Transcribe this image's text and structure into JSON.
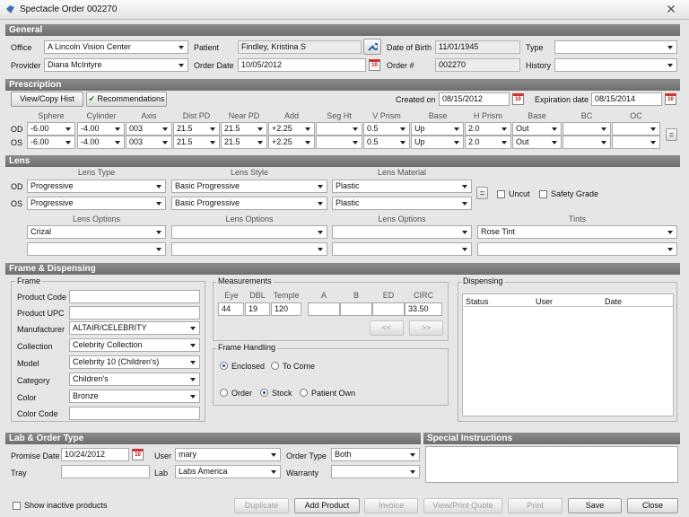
{
  "window": {
    "title": "Spectacle Order 002270"
  },
  "general": {
    "header": "General",
    "office_label": "Office",
    "office_value": "A Lincoln Vision Center",
    "patient_label": "Patient",
    "patient_value": "Findley, Kristina S",
    "dob_label": "Date of Birth",
    "dob_value": "11/01/1945",
    "type_label": "Type",
    "type_value": "",
    "provider_label": "Provider",
    "provider_value": "Diana McIntyre",
    "order_date_label": "Order Date",
    "order_date_value": "10/05/2012",
    "order_num_label": "Order #",
    "order_num_value": "002270",
    "history_label": "History",
    "history_value": ""
  },
  "prescription": {
    "header": "Prescription",
    "view_copy_button": "View/Copy Hist",
    "recommendations_button": "Recommendations",
    "created_label": "Created on",
    "created_value": "08/15/2012",
    "expiration_label": "Expiration date",
    "expiration_value": "08/15/2014",
    "columns": [
      "Sphere",
      "Cylinder",
      "Axis",
      "Dist PD",
      "Near PD",
      "Add",
      "Seg Ht",
      "V Prism",
      "Base",
      "H Prism",
      "Base",
      "BC",
      "OC"
    ],
    "rows": [
      {
        "eye": "OD",
        "values": [
          "-6.00",
          "-4.00",
          "003",
          "21.5",
          "21.5",
          "+2.25",
          "",
          "0.5",
          "Up",
          "2.0",
          "Out",
          "",
          ""
        ]
      },
      {
        "eye": "OS",
        "values": [
          "-6.00",
          "-4.00",
          "003",
          "21.5",
          "21.5",
          "+2.25",
          "",
          "0.5",
          "Up",
          "2.0",
          "Out",
          "",
          ""
        ]
      }
    ],
    "equals_button": "="
  },
  "lens": {
    "header": "Lens",
    "type_header": "Lens Type",
    "style_header": "Lens Style",
    "material_header": "Lens Material",
    "od_label": "OD",
    "os_label": "OS",
    "od": {
      "type": "Progressive",
      "style": "Basic Progressive",
      "material": "Plastic"
    },
    "os": {
      "type": "Progressive",
      "style": "Basic Progressive",
      "material": "Plastic"
    },
    "equals_button": "=",
    "uncut_label": "Uncut",
    "safety_label": "Safety Grade",
    "options_header": "Lens Options",
    "tints_header": "Tints",
    "options_row1": [
      "Crizal",
      "",
      "",
      "Rose Tint"
    ],
    "options_row2": [
      "",
      "",
      "",
      ""
    ]
  },
  "frame_dispensing": {
    "header": "Frame & Dispensing",
    "frame_group": "Frame",
    "fields": [
      {
        "label": "Product Code",
        "value": ""
      },
      {
        "label": "Product UPC",
        "value": ""
      },
      {
        "label": "Manufacturer",
        "value": "ALTAIR/CELEBRITY"
      },
      {
        "label": "Collection",
        "value": "Celebrity Collection"
      },
      {
        "label": "Model",
        "value": "Celebrity 10 (Children's)"
      },
      {
        "label": "Category",
        "value": "Children's"
      },
      {
        "label": "Color",
        "value": "Bronze"
      },
      {
        "label": "Color Code",
        "value": ""
      }
    ],
    "measurements_group": "Measurements",
    "meas_headers": [
      "Eye",
      "DBL",
      "Temple",
      "A",
      "B",
      "ED",
      "CIRC"
    ],
    "meas_values": [
      "44",
      "19",
      "120",
      "",
      "",
      "",
      "33.50"
    ],
    "prev_button": "<<",
    "next_button": ">>",
    "handling_group": "Frame Handling",
    "enclosed_label": "Enclosed",
    "to_come_label": "To Come",
    "order_label": "Order",
    "stock_label": "Stock",
    "patient_own_label": "Patient Own",
    "dispensing_group": "Dispensing",
    "disp_headers": [
      "Status",
      "User",
      "Date"
    ]
  },
  "lab_order": {
    "header": "Lab & Order Type",
    "promise_label": "Promise Date",
    "promise_value": "10/24/2012",
    "user_label": "User",
    "user_value": "mary",
    "order_type_label": "Order Type",
    "order_type_value": "Both",
    "tray_label": "Tray",
    "tray_value": "",
    "lab_label": "Lab",
    "lab_value": "Labs America",
    "warranty_label": "Warranty",
    "warranty_value": ""
  },
  "special": {
    "header": "Special Instructions",
    "text": ""
  },
  "footer": {
    "show_inactive": "Show inactive products",
    "duplicate": "Duplicate",
    "add_product": "Add Product",
    "invoice": "Invoice",
    "view_print_quote": "View/Print Quote",
    "print": "Print",
    "save": "Save",
    "close": "Close"
  }
}
